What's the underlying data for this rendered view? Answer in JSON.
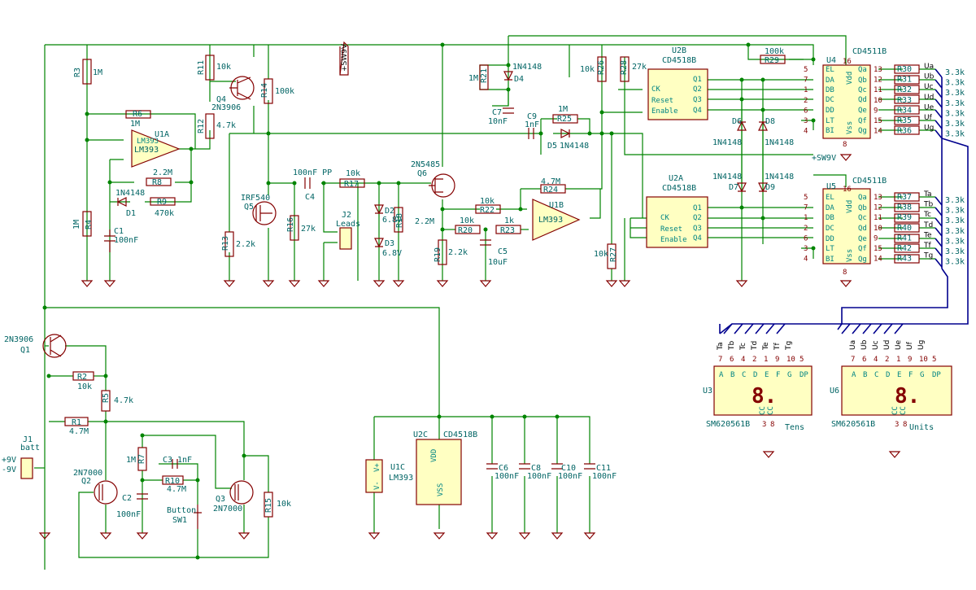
{
  "power_flag": "+SW9V",
  "labels": {
    "R3": "R3",
    "R3v": "1M",
    "R4": "R4",
    "R4v": "1M",
    "R6": "R6",
    "R6v": "1M",
    "R8": "R8",
    "R8v": "2.2M",
    "R9": "R9",
    "R9v": "470k",
    "R11": "R11",
    "R11v": "10k",
    "R12": "R12",
    "R12v": "4.7k",
    "R13": "R13",
    "R13v": "2.2k",
    "R14": "R14",
    "R14v": "100k",
    "R16": "R16",
    "R16v": "27k",
    "R17": "R17",
    "R17v": "10k",
    "R18": "R18",
    "R18v": "2.2M",
    "R19": "R19",
    "R19v": "2.2k",
    "R20": "R20",
    "R20v": "10k",
    "R21": "R21",
    "R21v": "1M",
    "R22": "R22",
    "R22v": "10k",
    "R23": "R23",
    "R23v": "1k",
    "R24": "R24",
    "R24v": "4.7M",
    "R25": "R25",
    "R25v": "1M",
    "R26": "R26",
    "R26v": "10k",
    "R27": "R27",
    "R27v": "10k",
    "R28": "R28",
    "R28v": "27k",
    "R29": "R29",
    "R29v": "100k",
    "R1": "R1",
    "R1v": "4.7M",
    "R2": "R2",
    "R2v": "10k",
    "R5": "R5",
    "R5v": "4.7k",
    "R7": "R7",
    "R7v": "1M",
    "R10": "R10",
    "R10v": "4.7M",
    "R15": "R15",
    "R15v": "10k",
    "C1": "C1",
    "C1v": "100nF",
    "C2": "C2",
    "C2v": "100nF",
    "C3": "C3",
    "C3v": "1nF",
    "C4": "C4",
    "C4v": "100nF PP",
    "C5": "C5",
    "C5v": "10uF",
    "C6": "C6",
    "C6v": "100nF",
    "C7": "C7",
    "C7v": "10nF",
    "C8": "C8",
    "C8v": "100nF",
    "C9": "C9",
    "C9v": "1nF",
    "C10": "C10",
    "C10v": "100nF",
    "C11": "C11",
    "C11v": "100nF",
    "D1": "D1",
    "D1v": "1N4148",
    "D2": "D2",
    "D2v": "6.8V",
    "D3": "D3",
    "D3v": "6.8V",
    "D4": "D4",
    "D4v": "1N4148",
    "D5": "D5",
    "D5v": "1N4148",
    "D6": "D6",
    "D6v": "1N4148",
    "D7": "D7",
    "D7v": "1N4148",
    "D8": "D8",
    "D8v": "1N4148",
    "D9": "D9",
    "D9v": "1N4148",
    "U1A": "U1A",
    "U1B": "U1B",
    "U1C": "U1C",
    "LM393": "LM393",
    "U2A": "U2A",
    "U2B": "U2B",
    "U2C": "U2C",
    "CD4518B": "CD4518B",
    "U4": "U4",
    "U5": "U5",
    "CD4511B": "CD4511B",
    "Q1": "Q1",
    "Q1v": "2N3906",
    "Q2": "Q2",
    "Q2v": "2N7000",
    "Q3": "Q3",
    "Q3v": "2N7000",
    "Q4": "Q4",
    "Q4v": "2N3906",
    "Q5": "Q5",
    "Q5v": "IRF540",
    "Q6": "Q6",
    "Q6v": "2N5485",
    "J1": "J1",
    "J1v": "batt",
    "J2": "J2",
    "J2v": "Leads",
    "SW1": "SW1",
    "SW1v": "Button",
    "plus9": "+9V",
    "minus9": "-9V",
    "U3": "U3",
    "U6": "U6",
    "SM": "SM620561B",
    "Tens": "Tens",
    "Units": "Units",
    "vdd": "VDD",
    "vss": "VSS",
    "v_plus": "V+",
    "v_minus": "V-",
    "seg_digit": "8.",
    "ck": "CK",
    "reset": "Reset",
    "enable": "Enable",
    "vdd4511": "Vdd",
    "vss4511": "Vss",
    "q1": "Q1",
    "q2": "Q2",
    "q3": "Q3",
    "q4": "Q4",
    "el": "EL",
    "da": "DA",
    "db": "DB",
    "dc": "DC",
    "dd": "DD",
    "lt": "LT",
    "bi": "BI",
    "qa": "Qa",
    "qb": "Qb",
    "qc": "Qc",
    "qd": "Qd",
    "qe": "Qe",
    "qf": "Qf",
    "qg": "Qg"
  },
  "seg_resistors_top": [
    {
      "ref": "R30",
      "val": "3.3k",
      "net": "Ua"
    },
    {
      "ref": "R31",
      "val": "3.3k",
      "net": "Ub"
    },
    {
      "ref": "R32",
      "val": "3.3k",
      "net": "Uc"
    },
    {
      "ref": "R33",
      "val": "3.3k",
      "net": "Ud"
    },
    {
      "ref": "R34",
      "val": "3.3k",
      "net": "Ue"
    },
    {
      "ref": "R35",
      "val": "3.3k",
      "net": "Uf"
    },
    {
      "ref": "R36",
      "val": "3.3k",
      "net": "Ug"
    }
  ],
  "seg_resistors_bottom": [
    {
      "ref": "R37",
      "val": "3.3k",
      "net": "Ta"
    },
    {
      "ref": "R38",
      "val": "3.3k",
      "net": "Tb"
    },
    {
      "ref": "R39",
      "val": "3.3k",
      "net": "Tc"
    },
    {
      "ref": "R40",
      "val": "3.3k",
      "net": "Td"
    },
    {
      "ref": "R41",
      "val": "3.3k",
      "net": "Te"
    },
    {
      "ref": "R42",
      "val": "3.3k",
      "net": "Tf"
    },
    {
      "ref": "R43",
      "val": "3.3k",
      "net": "Tg"
    }
  ],
  "pins4511": {
    "left": [
      "5",
      "7",
      "1",
      "2",
      "6",
      "3",
      "4"
    ],
    "right": [
      "13",
      "12",
      "11",
      "10",
      "9",
      "15",
      "14"
    ],
    "vdd": "16",
    "vss": "8"
  },
  "display_tens": {
    "nets": [
      "Ta",
      "Tb",
      "Tc",
      "Td",
      "Te",
      "Tf",
      "Tg"
    ],
    "pins": [
      "7",
      "6",
      "4",
      "2",
      "1",
      "9",
      "10"
    ],
    "dp_pin": "5",
    "segs": [
      "A",
      "B",
      "C",
      "D",
      "E",
      "F",
      "G"
    ],
    "dp": "DP",
    "bottom_pins": [
      "3",
      "8"
    ],
    "cc": "CC"
  },
  "display_units": {
    "nets": [
      "Ua",
      "Ub",
      "Uc",
      "Ud",
      "Ue",
      "Uf",
      "Ug"
    ],
    "pins": [
      "7",
      "6",
      "4",
      "2",
      "1",
      "9",
      "10"
    ],
    "dp_pin": "5",
    "segs": [
      "A",
      "B",
      "C",
      "D",
      "E",
      "F",
      "G"
    ],
    "dp": "DP",
    "bottom_pins": [
      "3",
      "8"
    ],
    "cc": "CC"
  }
}
